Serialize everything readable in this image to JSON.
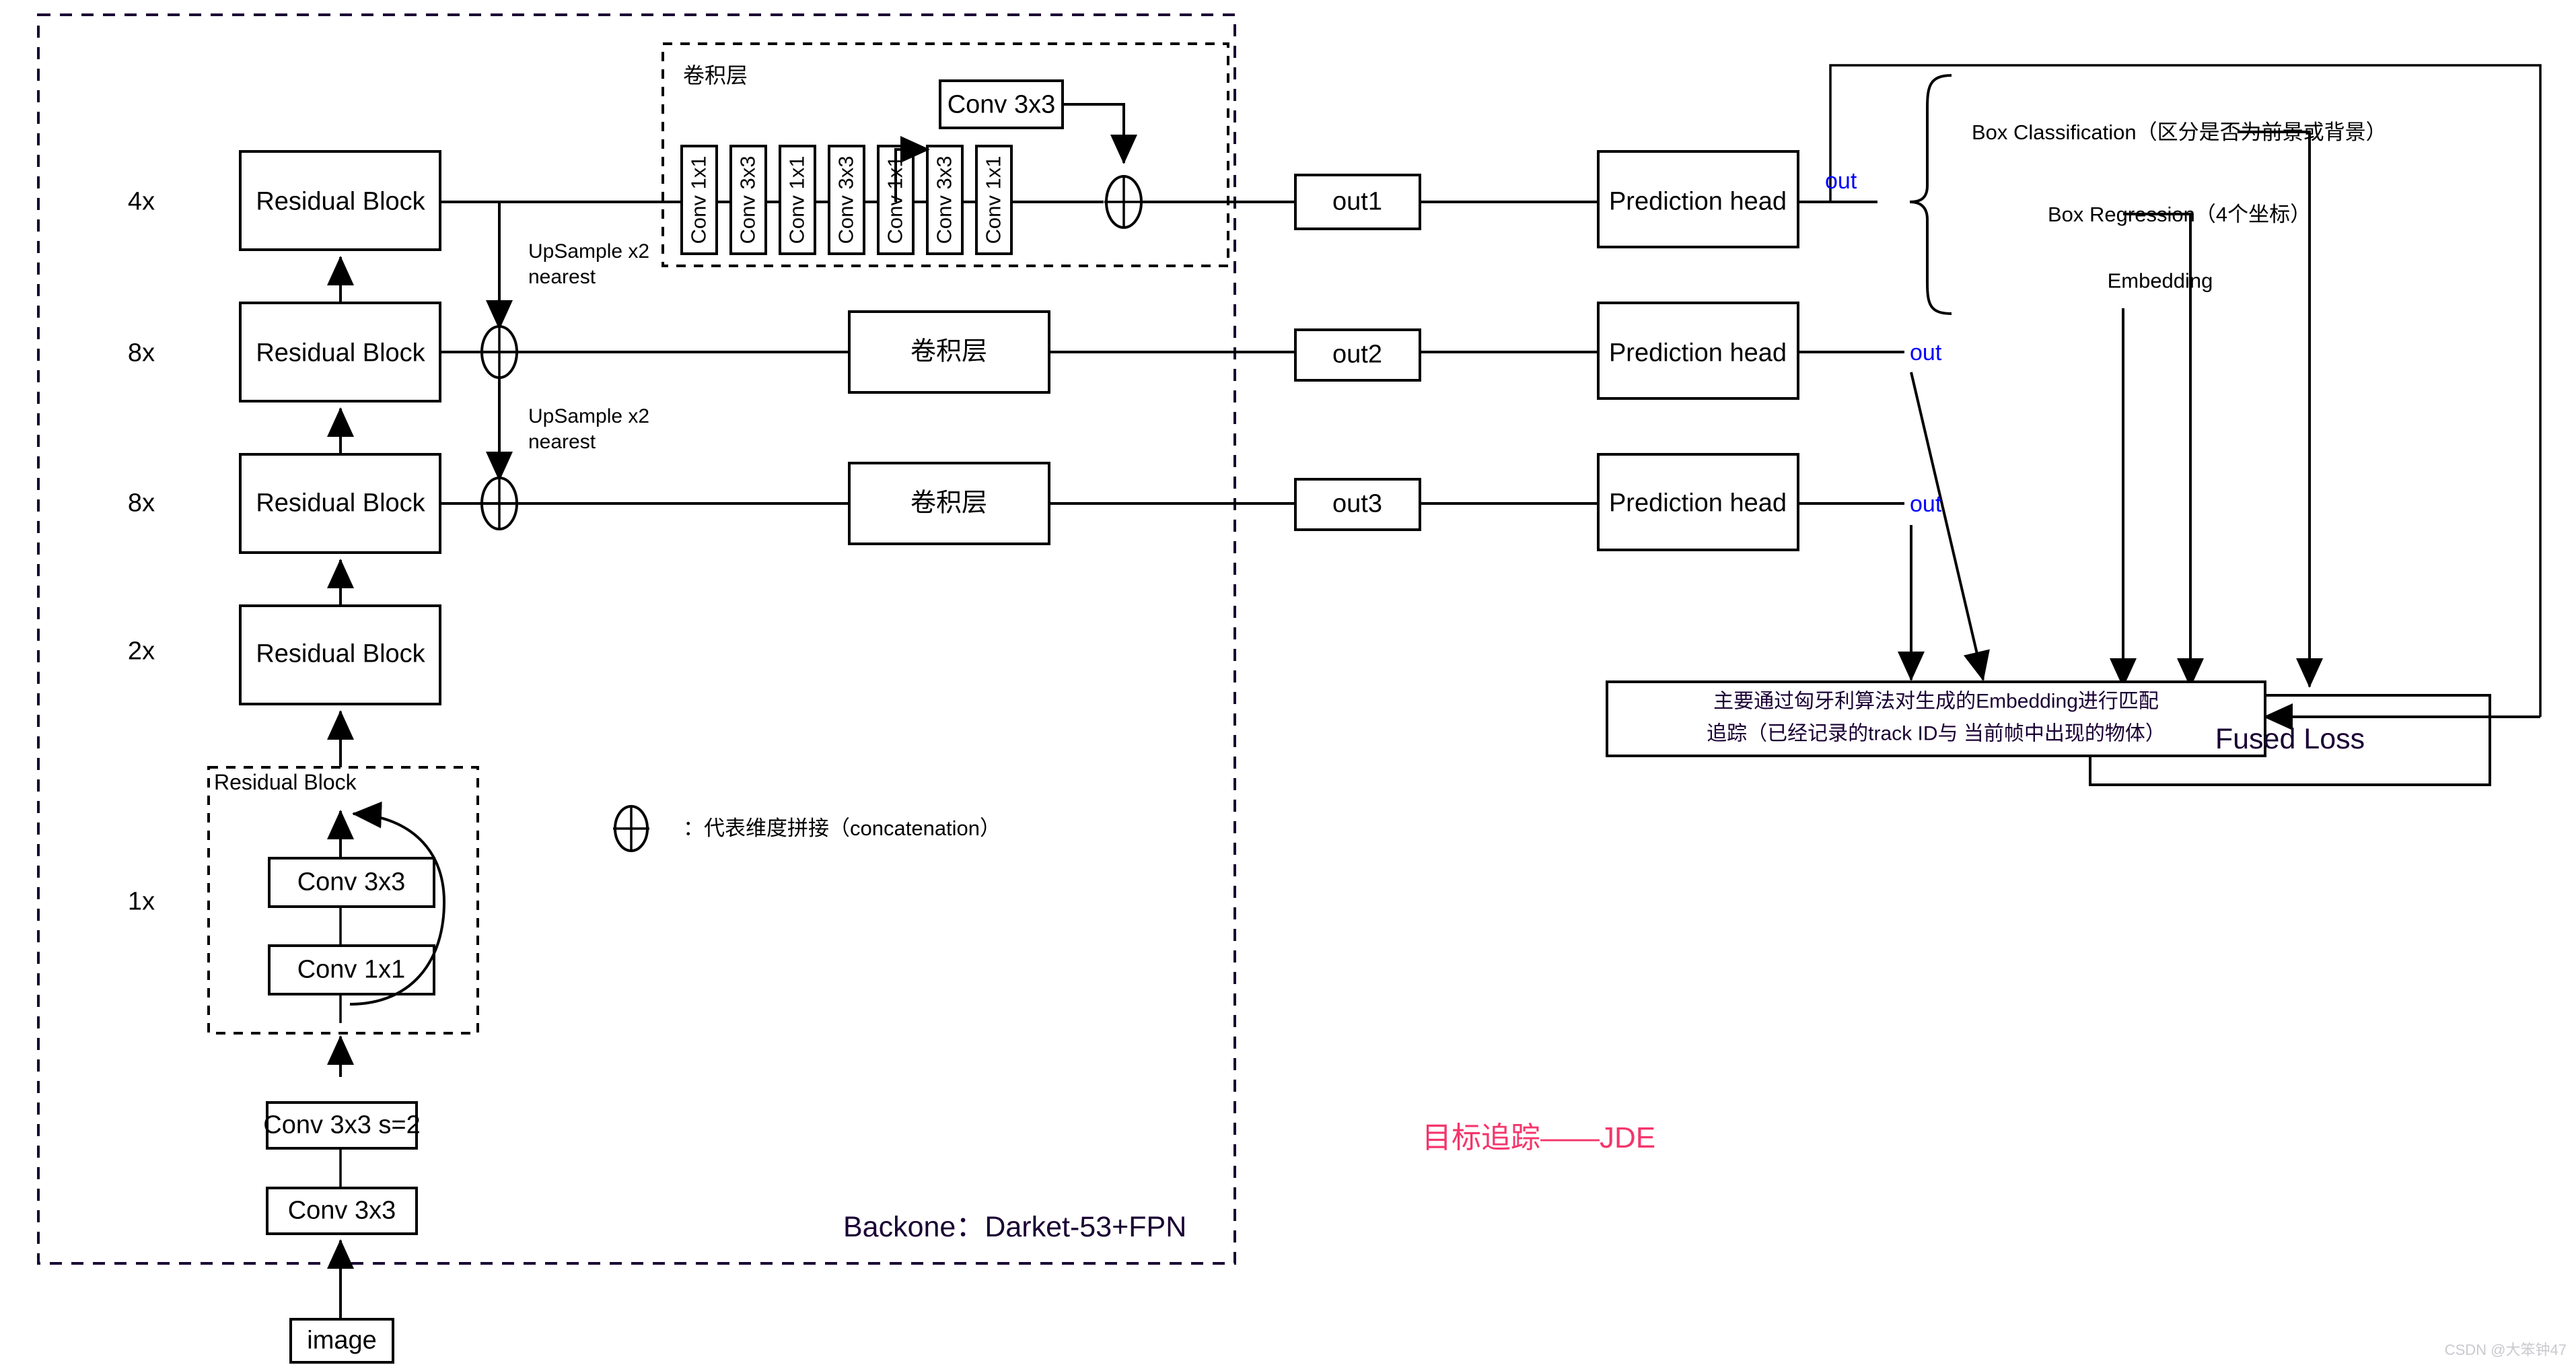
{
  "scale_labels": [
    "4x",
    "8x",
    "8x",
    "2x",
    "1x"
  ],
  "backbone": {
    "residual_blocks": [
      "Residual Block",
      "Residual Block",
      "Residual Block",
      "Residual Block"
    ],
    "detail_group_title": "Residual Block",
    "detail_convs": [
      "Conv 3x3",
      "Conv 1x1"
    ],
    "stem": [
      "Conv 3x3 s=2",
      "Conv 3x3"
    ],
    "input": "image",
    "upsample_labels": [
      "UpSample x2\nnearest",
      "UpSample x2\nnearest"
    ],
    "caption": "Backone：Darket-53+FPN"
  },
  "conv_group": {
    "title": "卷积层",
    "stack": [
      "Conv 1x1",
      "Conv 3x3",
      "Conv 1x1",
      "Conv 3x3",
      "Conv 1x1",
      "Conv 3x3",
      "Conv 1x1"
    ],
    "branch_conv": "Conv 3x3"
  },
  "fpn_conv_blocks": [
    "卷积层",
    "卷积层"
  ],
  "outputs": [
    "out1",
    "out2",
    "out3"
  ],
  "prediction_heads": [
    "Prediction head",
    "Prediction head",
    "Prediction head"
  ],
  "out_labels": [
    "out",
    "out",
    "out"
  ],
  "loss_branch": {
    "box_classification": "Box Classification（区分是否为前景或背景）",
    "box_regression": "Box Regression（4个坐标）",
    "embedding": "Embedding",
    "fused_loss": "Fused Loss"
  },
  "tracking_box": {
    "line1": "主要通过匈牙利算法对生成的Embedding进行匹配",
    "line2": "追踪（已经记录的track ID与 当前帧中出现的物体）"
  },
  "legend": {
    "symbol": "⊕",
    "text": "：代表维度拼接（concatenation）"
  },
  "title": "目标追踪——JDE",
  "watermark": "CSDN @大笨钟47",
  "colors": {
    "accent_blue": "#0000ff",
    "accent_pink": "#f4366b",
    "dark_purple": "#1a0033",
    "line": "#000000"
  }
}
